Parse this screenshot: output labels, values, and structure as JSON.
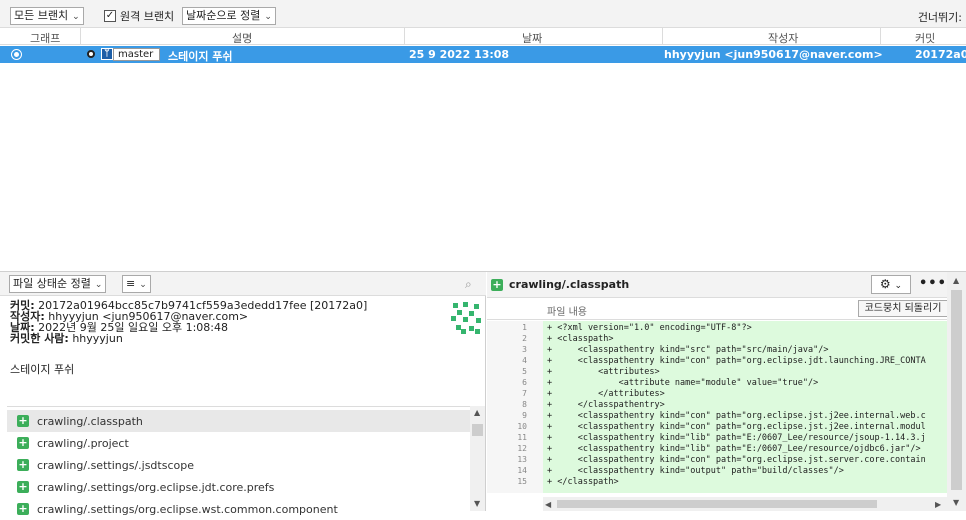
{
  "toolbar": {
    "branches_dropdown": "모든 브랜치",
    "remote_branches_label": "원격 브랜치",
    "remote_checked": true,
    "sort_dropdown": "날짜순으로 정렬",
    "skip_label": "건너뛰기:"
  },
  "columns": {
    "graph": "그래프",
    "description": "설명",
    "date": "날짜",
    "author": "작성자",
    "commit": "커밋"
  },
  "commit_row": {
    "branch": "master",
    "message": "스테이지 푸쉬",
    "date": "25 9 2022 13:08",
    "author": "hhyyyjun <jun950617@naver.com>",
    "hash": "20172a0"
  },
  "left_panel": {
    "sort_dropdown": "파일 상태순 정렬",
    "view_dropdown": "≡",
    "details": {
      "commit_label": "커밋:",
      "commit_value": "20172a01964bcc85c7b9741cf559a3ededd17fee [20172a0]",
      "author_label": "작성자:",
      "author_value": "hhyyyjun <jun950617@naver.com>",
      "date_label": "날짜:",
      "date_value": "2022년 9월 25일 일요일 오후 1:08:48",
      "committer_label": "커밋한 사람:",
      "committer_value": "hhyyyjun"
    },
    "message": "스테이지 푸쉬",
    "files": [
      "crawling/.classpath",
      "crawling/.project",
      "crawling/.settings/.jsdtscope",
      "crawling/.settings/org.eclipse.jdt.core.prefs",
      "crawling/.settings/org.eclipse.wst.common.component"
    ]
  },
  "right_panel": {
    "file_title": "crawling/.classpath",
    "content_label": "파일 내용",
    "revert_button": "코드뭉치 되돌리기",
    "lines": [
      {
        "n": "1",
        "text": "+ <?xml version=\"1.0\" encoding=\"UTF-8\"?>"
      },
      {
        "n": "2",
        "text": "+ <classpath>"
      },
      {
        "n": "3",
        "text": "+     <classpathentry kind=\"src\" path=\"src/main/java\"/>"
      },
      {
        "n": "4",
        "text": "+     <classpathentry kind=\"con\" path=\"org.eclipse.jdt.launching.JRE_CONTA"
      },
      {
        "n": "5",
        "text": "+         <attributes>"
      },
      {
        "n": "6",
        "text": "+             <attribute name=\"module\" value=\"true\"/>"
      },
      {
        "n": "7",
        "text": "+         </attributes>"
      },
      {
        "n": "8",
        "text": "+     </classpathentry>"
      },
      {
        "n": "9",
        "text": "+     <classpathentry kind=\"con\" path=\"org.eclipse.jst.j2ee.internal.web.c"
      },
      {
        "n": "10",
        "text": "+     <classpathentry kind=\"con\" path=\"org.eclipse.jst.j2ee.internal.modul"
      },
      {
        "n": "11",
        "text": "+     <classpathentry kind=\"lib\" path=\"E:/0607_Lee/resource/jsoup-1.14.3.j"
      },
      {
        "n": "12",
        "text": "+     <classpathentry kind=\"lib\" path=\"E:/0607_Lee/resource/ojdbc6.jar\"/>"
      },
      {
        "n": "13",
        "text": "+     <classpathentry kind=\"con\" path=\"org.eclipse.jst.server.core.contain"
      },
      {
        "n": "14",
        "text": "+     <classpathentry kind=\"output\" path=\"build/classes\"/>"
      },
      {
        "n": "15",
        "text": "+ </classpath>"
      }
    ]
  },
  "colors": {
    "selection": "#3a9ae6",
    "added_bg": "#ddfadd",
    "added_icon": "#3cae5a"
  }
}
